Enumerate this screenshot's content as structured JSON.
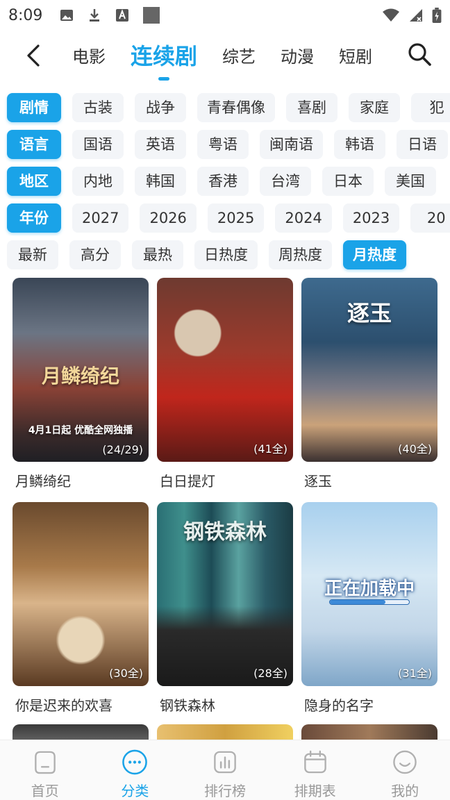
{
  "status_bar": {
    "time": "8:09"
  },
  "top_nav": {
    "tabs": [
      {
        "label": "电影",
        "active": false
      },
      {
        "label": "连续剧",
        "active": true
      },
      {
        "label": "综艺",
        "active": false
      },
      {
        "label": "动漫",
        "active": false
      },
      {
        "label": "短剧",
        "active": false
      }
    ]
  },
  "filters": {
    "genre": {
      "label": "剧情",
      "options": [
        "古装",
        "战争",
        "青春偶像",
        "喜剧",
        "家庭",
        "犯"
      ]
    },
    "language": {
      "label": "语言",
      "options": [
        "国语",
        "英语",
        "粤语",
        "闽南语",
        "韩语",
        "日语"
      ]
    },
    "region": {
      "label": "地区",
      "options": [
        "内地",
        "韩国",
        "香港",
        "台湾",
        "日本",
        "美国"
      ]
    },
    "year": {
      "label": "年份",
      "options": [
        "2027",
        "2026",
        "2025",
        "2024",
        "2023",
        "20"
      ]
    },
    "sort": {
      "options": [
        "最新",
        "高分",
        "最热",
        "日热度",
        "周热度",
        "月热度"
      ],
      "selected": "月热度"
    }
  },
  "shows": [
    {
      "title": "月鳞绮纪",
      "episodes": "(24/29)",
      "caption": "月鳞绮纪",
      "footer": "4月1日起 优酷全网独播"
    },
    {
      "title": "白日提灯",
      "episodes": "(41全)"
    },
    {
      "title": "逐玉",
      "episodes": "(40全)",
      "caption": "逐玉"
    },
    {
      "title": "你是迟来的欢喜",
      "episodes": "(30全)"
    },
    {
      "title": "钢铁森林",
      "episodes": "(28全)",
      "caption": "钢铁森林"
    },
    {
      "title": "隐身的名字",
      "episodes": "(31全)",
      "caption": "正在加载中"
    }
  ],
  "bottom_nav": [
    {
      "label": "首页",
      "icon": "home-icon"
    },
    {
      "label": "分类",
      "icon": "category-icon",
      "active": true
    },
    {
      "label": "排行榜",
      "icon": "ranking-icon"
    },
    {
      "label": "排期表",
      "icon": "calendar-icon"
    },
    {
      "label": "我的",
      "icon": "profile-icon"
    }
  ],
  "colors": {
    "accent": "#1aa3e8",
    "chip_bg": "#f3f5f8",
    "inactive": "#999999"
  }
}
